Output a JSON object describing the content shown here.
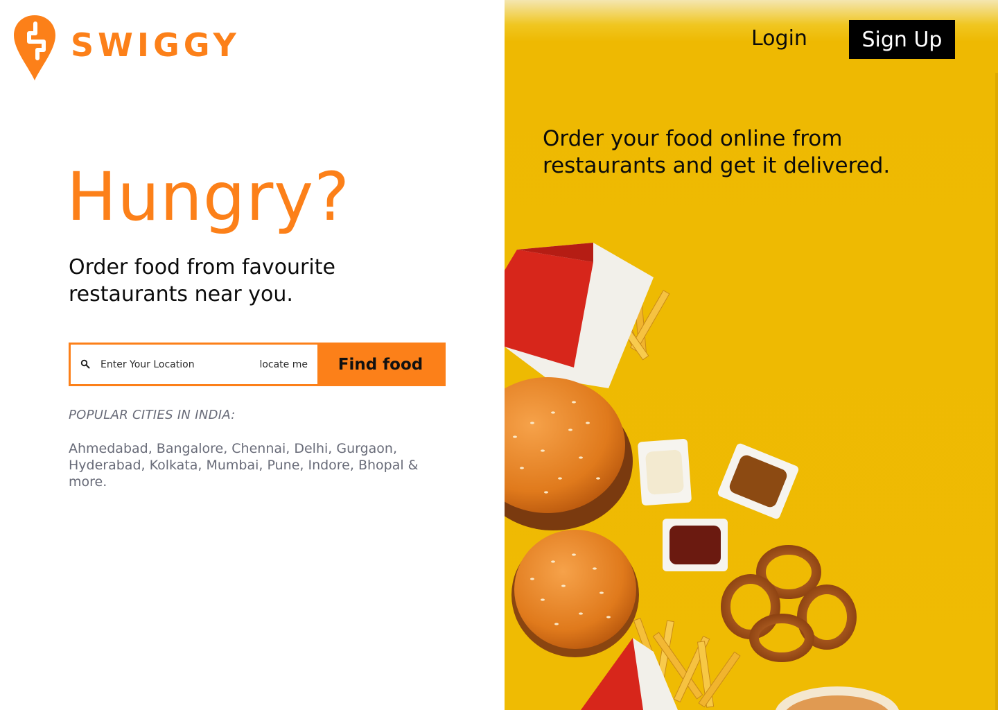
{
  "brand": {
    "name": "SWIGGY",
    "color": "#fc8019",
    "logo_icon": "swiggy-pin-logo-icon"
  },
  "hero": {
    "title": "Hungry?",
    "subtitle": "Order food from favourite restaurants near you."
  },
  "search": {
    "placeholder": "Enter Your Location",
    "icon": "search-icon",
    "locate_label": "locate me",
    "button_label": "Find food"
  },
  "popular": {
    "title": "POPULAR CITIES IN INDIA:",
    "cities_text": "Ahmedabad, Bangalore, Chennai, Delhi, Gurgaon, Hyderabad, Kolkata, Mumbai, Pune, Indore, Bhopal & more."
  },
  "header": {
    "login_label": "Login",
    "signup_label": "Sign Up"
  },
  "banner": {
    "tagline": "Order your food online from restaurants and get it delivered.",
    "image_subject": "fast-food-photo (fries, burgers, dips, onion rings)",
    "background_color": "#efbb03"
  }
}
